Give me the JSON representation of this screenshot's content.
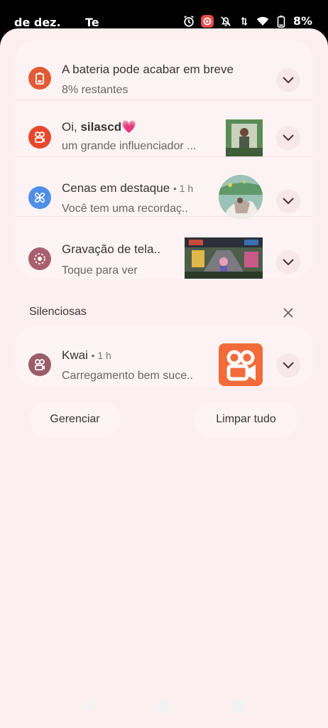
{
  "status_bar": {
    "date": "de dez.",
    "app": "Te",
    "battery": "8%",
    "icons": [
      "alarm-icon",
      "screen-record-icon",
      "bell-off-icon",
      "data-arrows-icon",
      "wifi-icon",
      "battery-icon"
    ]
  },
  "notifications": [
    {
      "title": "A bateria pode acabar em breve",
      "time": "",
      "body": "8% restantes",
      "icon": "battery-warning-icon",
      "color": "#e25b36"
    },
    {
      "title_prefix": "Oi, ",
      "title_bold": "silascd",
      "emoji": "💗",
      "body": "um grande influenciador ...",
      "icon": "kwai-icon",
      "color": "#e8472e"
    },
    {
      "title": "Cenas em destaque",
      "time": "• 1 h",
      "body": "Você tem uma recordaç..",
      "icon": "gallery-icon",
      "color": "#4f8ee8"
    },
    {
      "title": "Gravação de tela..",
      "time": "",
      "body": "Toque para ver",
      "icon": "screen-record-icon",
      "color": "#a9606e"
    }
  ],
  "silent_section": {
    "label": "Silenciosas",
    "notification": {
      "title": "Kwai",
      "time": "• 1 h",
      "body": "Carregamento bem suce..",
      "icon": "kwai-icon",
      "color": "#9a5d69"
    }
  },
  "actions": {
    "manage": "Gerenciar",
    "clear_all": "Limpar tudo"
  },
  "colors": {
    "shade": "#fbeff0",
    "card": "#fdf3f4",
    "kwai_orange": "#f26b3a"
  }
}
